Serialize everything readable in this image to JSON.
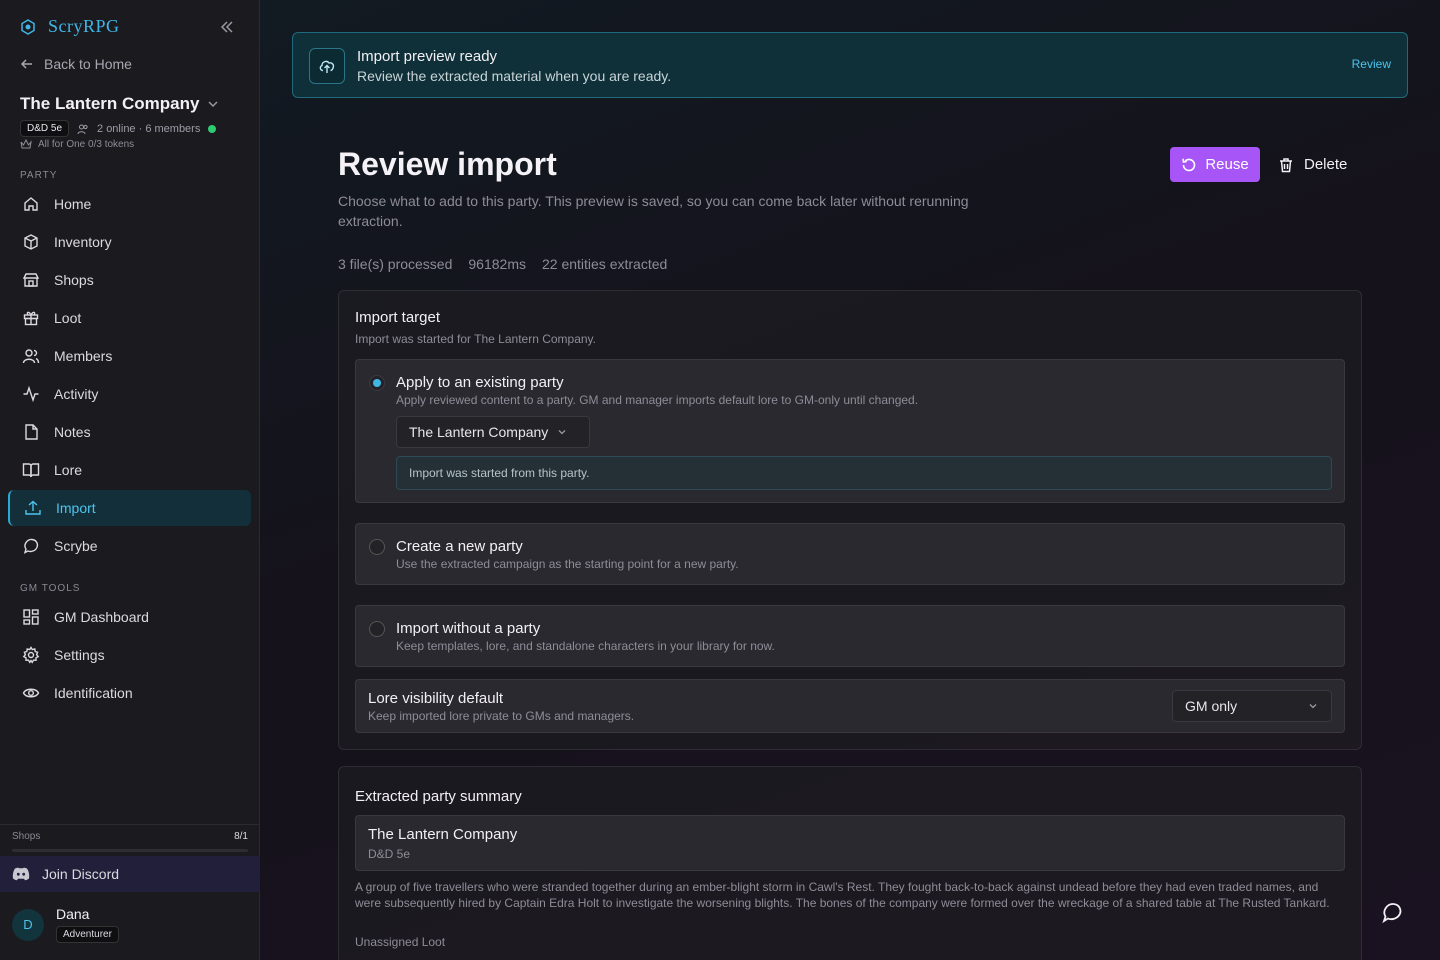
{
  "sidebar": {
    "brand": "ScryRPG",
    "back_label": "Back to Home",
    "party_name": "The Lantern Company",
    "system_badge": "D&D 5e",
    "presence": "2 online · 6 members",
    "tokens": "All for One 0/3 tokens",
    "party_section": "PARTY",
    "gm_section": "GM TOOLS",
    "nav": [
      {
        "label": "Home",
        "icon": "home-icon"
      },
      {
        "label": "Inventory",
        "icon": "package-icon"
      },
      {
        "label": "Shops",
        "icon": "store-icon"
      },
      {
        "label": "Loot",
        "icon": "gift-icon"
      },
      {
        "label": "Members",
        "icon": "users-icon"
      },
      {
        "label": "Activity",
        "icon": "activity-icon"
      },
      {
        "label": "Notes",
        "icon": "file-icon"
      },
      {
        "label": "Lore",
        "icon": "book-icon"
      },
      {
        "label": "Import",
        "icon": "upload-icon"
      },
      {
        "label": "Scrybe",
        "icon": "chat-icon"
      }
    ],
    "gm_nav": [
      {
        "label": "GM Dashboard",
        "icon": "dashboard-icon"
      },
      {
        "label": "Settings",
        "icon": "gear-icon"
      },
      {
        "label": "Identification",
        "icon": "eye-icon"
      }
    ],
    "shops_label": "Shops",
    "shops_count": "8/1",
    "discord_label": "Join Discord",
    "user": {
      "initial": "D",
      "name": "Dana",
      "role": "Adventurer"
    }
  },
  "banner": {
    "title": "Import preview ready",
    "subtitle": "Review the extracted material when you are ready.",
    "link": "Review"
  },
  "page": {
    "title": "Review import",
    "description": "Choose what to add to this party. This preview is saved, so you can come back later without rerunning extraction.",
    "reuse_label": "Reuse",
    "delete_label": "Delete",
    "stats": [
      "3 file(s) processed",
      "96182ms",
      "22 entities extracted"
    ]
  },
  "import_target": {
    "title": "Import target",
    "subtitle": "Import was started for The Lantern Company.",
    "options": [
      {
        "title": "Apply to an existing party",
        "subtitle": "Apply reviewed content to a party. GM and manager imports default lore to GM-only until changed.",
        "selected": true
      },
      {
        "title": "Create a new party",
        "subtitle": "Use the extracted campaign as the starting point for a new party.",
        "selected": false
      },
      {
        "title": "Import without a party",
        "subtitle": "Keep templates, lore, and standalone characters in your library for now.",
        "selected": false
      }
    ],
    "party_select": "The Lantern Company",
    "party_info": "Import was started from this party.",
    "lore_title": "Lore visibility default",
    "lore_subtitle": "Keep imported lore private to GMs and managers.",
    "lore_select": "GM only"
  },
  "summary": {
    "title": "Extracted party summary",
    "party_name": "The Lantern Company",
    "system": "D&D 5e",
    "description": "A group of five travellers who were stranded together during an ember-blight storm in Cawl's Rest. They fought back-to-back against undead before they had even traded names, and were subsequently hired by Captain Edra Holt to investigate the worsening blights. The bones of the company were formed over the wreckage of a shared table at The Rusted Tankard.",
    "loot_label": "Unassigned Loot"
  },
  "colors": {
    "accent": "#3fb6e6",
    "primary_button": "#a855f7",
    "online": "#2ecc71"
  }
}
